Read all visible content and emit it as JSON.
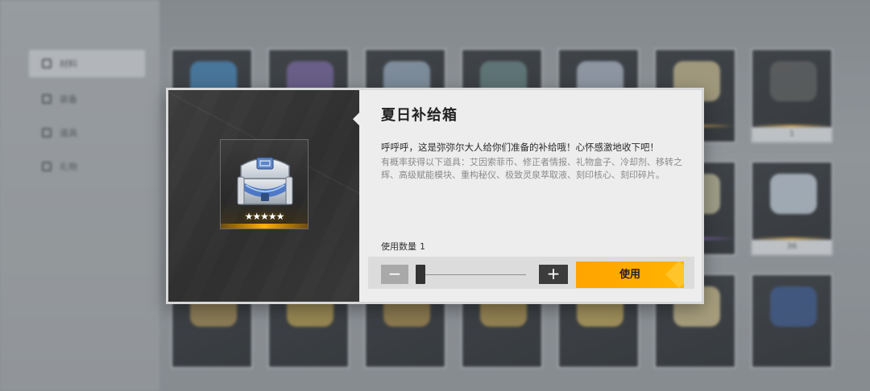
{
  "sidebar": {
    "items": [
      {
        "label": "材料",
        "active": true
      },
      {
        "label": "装备",
        "active": false
      },
      {
        "label": "道具",
        "active": false
      },
      {
        "label": "礼物",
        "active": false
      }
    ]
  },
  "grid": {
    "slot_counts": [
      "",
      "",
      "",
      "",
      "",
      "",
      "1",
      "",
      "",
      "",
      "",
      "",
      "",
      "36"
    ]
  },
  "modal": {
    "title": "夏日补给箱",
    "description": "呼呼呼，这是弥弥尔大人给你们准备的补给哦！心怀感激地收下吧！",
    "contents": "有概率获得以下道具：艾因索菲币、修正者情报、礼物盒子、冷却剂、移转之辉、高级赋能模块、重构秘仪、极致灵泉萃取液、刻印核心、刻印碎片。",
    "item_rarity": "★★★★★",
    "quantity_label": "使用数量",
    "quantity_value": "1",
    "quantity_fraction": 0.0,
    "minus_label": "−",
    "plus_label": "+",
    "use_label": "使用",
    "accent_color": "#ffa400"
  }
}
